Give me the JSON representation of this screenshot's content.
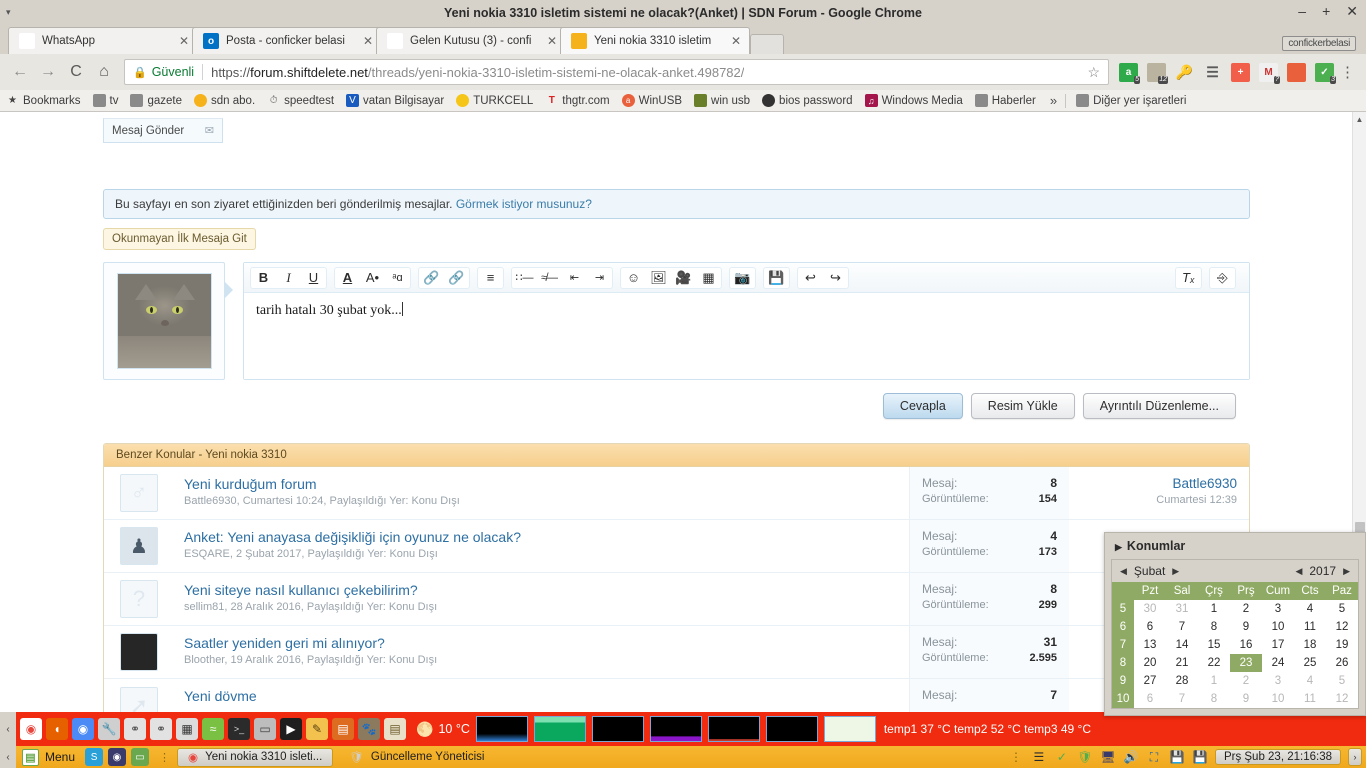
{
  "window": {
    "title": "Yeni nokia 3310 isletim sistemi ne olacak?(Anket) | SDN Forum - Google Chrome",
    "minimize": "–",
    "maximize": "+",
    "close": "✕",
    "menu_caret": "▾",
    "profile_name": "confickerbelasi"
  },
  "tabs": [
    {
      "label": "WhatsApp",
      "icon": "whatsapp-icon",
      "glyph": "✆",
      "close": "✕",
      "active": false
    },
    {
      "label": "Posta - conficker belasi",
      "icon": "outlook-icon",
      "glyph": "o",
      "close": "✕",
      "active": false
    },
    {
      "label": "Gelen Kutusu (3) - confi",
      "icon": "gmail-icon",
      "glyph": "M",
      "close": "✕",
      "active": false
    },
    {
      "label": "Yeni nokia 3310 isletim",
      "icon": "sdn-forum-icon",
      "glyph": "",
      "close": "✕",
      "active": true
    }
  ],
  "toolbar": {
    "back": "←",
    "forward": "→",
    "reload": "C",
    "home": "⌂",
    "lock_glyph": "🔒",
    "secure_label": "Güvenli",
    "url_scheme": "https://",
    "url_host": "forum.shiftdelete.net",
    "url_path": "/threads/yeni-nokia-3310-isletim-sistemi-ne-olacak-anket.498782/",
    "star": "☆",
    "menu": "⋮",
    "extensions": [
      {
        "name": "adblock-extension",
        "glyph": "a",
        "color": "#2faa4a",
        "badge": "5"
      },
      {
        "name": "cookie-extension",
        "glyph": "",
        "color": "#b9b39f",
        "badge": "12"
      },
      {
        "name": "key-extension",
        "glyph": "🔑",
        "color": "transparent",
        "badge": ""
      },
      {
        "name": "sliders-extension",
        "glyph": "⫿",
        "color": "transparent",
        "badge": ""
      },
      {
        "name": "plus-extension",
        "glyph": "+",
        "color": "#f15f4b",
        "badge": ""
      },
      {
        "name": "gmail-checker-extension",
        "glyph": "M",
        "color": "#f0f0f0",
        "badge": "?"
      },
      {
        "name": "flame-extension",
        "glyph": "",
        "color": "#e8603c",
        "badge": ""
      },
      {
        "name": "shield-extension",
        "glyph": "✓",
        "color": "#4caf50",
        "badge": "3"
      }
    ]
  },
  "bookmarks": {
    "items": [
      {
        "label": "Bookmarks",
        "icon": "star-icon",
        "glyph": "★",
        "color": "#444"
      },
      {
        "label": "tv",
        "icon": "folder-icon",
        "glyph": "",
        "color": "#8a8a8a"
      },
      {
        "label": "gazete",
        "icon": "folder-icon",
        "glyph": "",
        "color": "#8a8a8a"
      },
      {
        "label": "sdn abo.",
        "icon": "sdn-icon",
        "glyph": "",
        "color": "#f6b21b"
      },
      {
        "label": "speedtest",
        "icon": "speedtest-icon",
        "glyph": "◴",
        "color": "#666"
      },
      {
        "label": "vatan Bilgisayar",
        "icon": "vatan-icon",
        "glyph": "V",
        "color": "#1a5bbf"
      },
      {
        "label": "TURKCELL",
        "icon": "turkcell-icon",
        "glyph": "",
        "color": "#f5c518"
      },
      {
        "label": "thgtr.com",
        "icon": "thg-icon",
        "glyph": "T",
        "color": "#d22"
      },
      {
        "label": "WinUSB",
        "icon": "ask-icon",
        "glyph": "a",
        "color": "#e8603c"
      },
      {
        "label": "win usb",
        "icon": "winusb-icon",
        "glyph": "",
        "color": "#6a7f2a"
      },
      {
        "label": "bios password",
        "icon": "bios-icon",
        "glyph": "",
        "color": "#333"
      },
      {
        "label": "Windows Media",
        "icon": "wmp-icon",
        "glyph": "",
        "color": "#a3154b"
      },
      {
        "label": "Haberler",
        "icon": "folder-icon",
        "glyph": "",
        "color": "#8a8a8a"
      }
    ],
    "overflow": "»",
    "other_bookmarks": {
      "label": "Diğer yer işaretleri",
      "icon": "folder-icon"
    }
  },
  "page": {
    "msg_gonder": {
      "label": "Mesaj Gönder",
      "icon_name": "envelope-icon",
      "glyph": "✉"
    },
    "notice": {
      "text": "Bu sayfayı en son ziyaret ettiğinizden beri gönderilmiş mesajlar.",
      "link": "Görmek istiyor musunuz?"
    },
    "jump_button": "Okunmayan İlk Mesaja Git",
    "editor": {
      "avatar_name": "user-avatar-cat",
      "body_text": "tarih hatalı 30 şubat yok...",
      "toolbar_groups": [
        [
          {
            "n": "bold-icon",
            "g": "B",
            "s": "bold"
          },
          {
            "n": "italic-icon",
            "g": "I",
            "s": "italic"
          },
          {
            "n": "underline-icon",
            "g": "U",
            "s": "underline"
          }
        ],
        [
          {
            "n": "text-color-icon",
            "g": "A",
            "s": "color"
          },
          {
            "n": "font-size-icon",
            "g": "A",
            "s": "size"
          },
          {
            "n": "font-family-icon",
            "g": "a",
            "s": "family"
          }
        ],
        [
          {
            "n": "insert-link-icon",
            "g": "🔗",
            "s": ""
          },
          {
            "n": "remove-link-icon",
            "g": "🔗",
            "s": "strike"
          }
        ],
        [
          {
            "n": "align-icon",
            "g": "≡",
            "s": ""
          }
        ],
        [
          {
            "n": "bullet-list-icon",
            "g": "☰",
            "s": ""
          },
          {
            "n": "numbered-list-icon",
            "g": "☰",
            "s": ""
          },
          {
            "n": "outdent-icon",
            "g": "⇤",
            "s": ""
          },
          {
            "n": "indent-icon",
            "g": "⇥",
            "s": ""
          }
        ],
        [
          {
            "n": "emoji-icon",
            "g": "☺",
            "s": ""
          },
          {
            "n": "insert-image-icon",
            "g": "▣",
            "s": ""
          },
          {
            "n": "insert-media-icon",
            "g": "▤",
            "s": ""
          },
          {
            "n": "insert-quote-icon",
            "g": "▥",
            "s": ""
          }
        ],
        [
          {
            "n": "screenshot-icon",
            "g": "📷",
            "s": ""
          }
        ],
        [
          {
            "n": "save-draft-icon",
            "g": "💾",
            "s": ""
          }
        ],
        [
          {
            "n": "undo-icon",
            "g": "↩",
            "s": ""
          },
          {
            "n": "redo-icon",
            "g": "↪",
            "s": ""
          }
        ]
      ],
      "toolbar_right": [
        {
          "n": "remove-formatting-icon",
          "g": "Tx"
        },
        {
          "n": "toggle-bbcode-icon",
          "g": "⌨"
        }
      ]
    },
    "buttons": {
      "reply": "Cevapla",
      "upload_image": "Resim Yükle",
      "more_options": "Ayrıntılı Düzenleme..."
    },
    "similar": {
      "header": "Benzer Konular - Yeni nokia 3310",
      "labels": {
        "messages": "Mesaj:",
        "views": "Görüntüleme:"
      },
      "rows": [
        {
          "title": "Yeni kurduğum forum",
          "meta": "Battle6930, Cumartesi 10:24, Paylaşıldığı Yer: Konu Dışı",
          "messages": "8",
          "views": "154",
          "last_user": "Battle6930",
          "last_time": "Cumartesi 12:39",
          "avatar_glyph": "♂"
        },
        {
          "title": "Anket: Yeni anayasa değişikliği için oyunuz ne olacak?",
          "meta": "ESQARE, 2 Şubat 2017, Paylaşıldığı Yer: Konu Dışı",
          "messages": "4",
          "views": "173",
          "last_user": "",
          "last_time": "",
          "avatar_glyph": ""
        },
        {
          "title": "Yeni siteye nasıl kullanıcı çekebilirim?",
          "meta": "sellim81, 28 Aralık 2016, Paylaşıldığı Yer: Konu Dışı",
          "messages": "8",
          "views": "299",
          "last_user": "",
          "last_time": "",
          "avatar_glyph": "?"
        },
        {
          "title": "Saatler yeniden geri mi alınıyor?",
          "meta": "Bloother, 19 Aralık 2016, Paylaşıldığı Yer: Konu Dışı",
          "messages": "31",
          "views": "2.595",
          "last_user": "",
          "last_time": "",
          "avatar_glyph": ""
        },
        {
          "title": "Yeni dövme",
          "meta": "",
          "messages": "7",
          "views": "",
          "last_user": "",
          "last_time": "",
          "avatar_glyph": "➚"
        }
      ]
    }
  },
  "calendar": {
    "konumlar": "Konumlar",
    "konumlar_tri": "▶",
    "month": "Şubat",
    "year": "2017",
    "prev": "◀",
    "next": "▶",
    "dow": [
      "Pzt",
      "Sal",
      "Çrş",
      "Prş",
      "Cum",
      "Cts",
      "Paz"
    ],
    "weeks": [
      {
        "wk": "5",
        "days": [
          "30",
          "31",
          "1",
          "2",
          "3",
          "4",
          "5"
        ],
        "muted": [
          0,
          1
        ],
        "sel": -1
      },
      {
        "wk": "6",
        "days": [
          "6",
          "7",
          "8",
          "9",
          "10",
          "11",
          "12"
        ],
        "muted": [],
        "sel": -1
      },
      {
        "wk": "7",
        "days": [
          "13",
          "14",
          "15",
          "16",
          "17",
          "18",
          "19"
        ],
        "muted": [],
        "sel": -1
      },
      {
        "wk": "8",
        "days": [
          "20",
          "21",
          "22",
          "23",
          "24",
          "25",
          "26"
        ],
        "muted": [],
        "sel": 3
      },
      {
        "wk": "9",
        "days": [
          "27",
          "28",
          "1",
          "2",
          "3",
          "4",
          "5"
        ],
        "muted": [
          2,
          3,
          4,
          5,
          6
        ],
        "sel": -1
      },
      {
        "wk": "10",
        "days": [
          "6",
          "7",
          "8",
          "9",
          "10",
          "11",
          "12"
        ],
        "muted": [
          0,
          1,
          2,
          3,
          4,
          5,
          6
        ],
        "sel": -1
      }
    ]
  },
  "conky": {
    "collapse": "‹",
    "weather_icon": "weather-icon",
    "weather_temp": "10 °C",
    "temps": "temp1 37 °C temp2 52 °C temp3 49 °C",
    "dock": [
      {
        "n": "chrome-dock-icon",
        "g": "",
        "c": "#e8453c"
      },
      {
        "n": "firefox-dock-icon",
        "g": "",
        "c": "#e66000"
      },
      {
        "n": "chromium-dock-icon",
        "g": "",
        "c": "#4c8bf5"
      },
      {
        "n": "settings-dock-icon",
        "g": "🔧",
        "c": "#c8c8c8"
      },
      {
        "n": "usb-dock-icon",
        "g": "⚲",
        "c": "#dcdcdc"
      },
      {
        "n": "usb2-dock-icon",
        "g": "⚲",
        "c": "#dcdcdc"
      },
      {
        "n": "calculator-dock-icon",
        "g": "▦",
        "c": "#dcdcdc"
      },
      {
        "n": "wifi-dock-icon",
        "g": "≋",
        "c": "#7ac143"
      },
      {
        "n": "terminal-dock-icon",
        "g": ">_",
        "c": "#2b2b2b"
      },
      {
        "n": "window-dock-icon",
        "g": "▭",
        "c": "#b9b9b9"
      },
      {
        "n": "video-player-dock-icon",
        "g": "▶",
        "c": "#1e1e1e"
      },
      {
        "n": "editor-dock-icon",
        "g": "✎",
        "c": "#f2c14e"
      },
      {
        "n": "presentation-dock-icon",
        "g": "▤",
        "c": "#dd6b20"
      },
      {
        "n": "gimp-dock-icon",
        "g": "",
        "c": "#7a6a52"
      },
      {
        "n": "notes-dock-icon",
        "g": "▤",
        "c": "#e8e0c8"
      }
    ]
  },
  "taskbar": {
    "collapse": "‹",
    "menu": "Menu",
    "quick": [
      {
        "n": "skype-quicklaunch",
        "g": "S",
        "c": "#29a0d8"
      },
      {
        "n": "browser-quicklaunch",
        "g": "",
        "c": "#3b3b6b"
      },
      {
        "n": "show-desktop-quicklaunch",
        "g": "",
        "c": "#6aa84f"
      }
    ],
    "grip": "⋮",
    "tasks": [
      {
        "label": "Yeni nokia 3310 isleti...",
        "icon": "chrome-icon",
        "active": true
      },
      {
        "label": "Güncelleme Yöneticisi",
        "icon": "shield-icon",
        "active": false
      }
    ],
    "tray": [
      {
        "n": "tray-grip",
        "g": "⋮"
      },
      {
        "n": "network-signal-icon",
        "g": "▂▄▆"
      },
      {
        "n": "update-manager-icon",
        "g": "✓"
      },
      {
        "n": "shield-tray-icon",
        "g": "✓"
      },
      {
        "n": "display-tray-icon",
        "g": "🖵"
      },
      {
        "n": "volume-tray-icon",
        "g": "🔊"
      },
      {
        "n": "battery-tray-icon",
        "g": "▭"
      },
      {
        "n": "disk-tray-icon",
        "g": "💾"
      },
      {
        "n": "disk2-tray-icon",
        "g": "💾"
      }
    ],
    "clock": "Prş Şub 23, 21:16:38",
    "tray_arrow": "›"
  }
}
